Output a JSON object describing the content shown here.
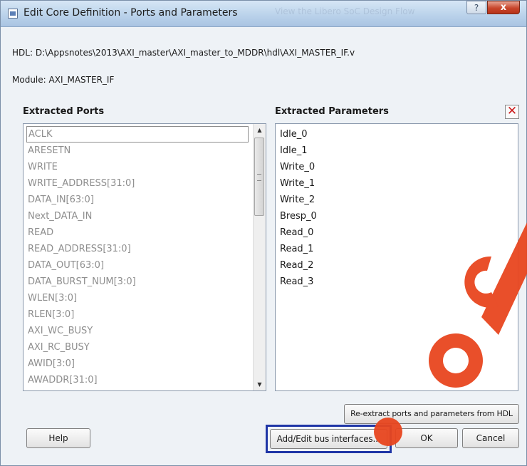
{
  "window": {
    "title": "Edit Core Definition - Ports and Parameters",
    "background_tab": "View the Libero SoC Design Flow",
    "help_glyph": "?",
    "close_glyph": "x"
  },
  "hdl": {
    "label": "HDL:",
    "path": "D:\\Appsnotes\\2013\\AXI_master\\AXI_master_to_MDDR\\hdl\\AXI_MASTER_IF.v"
  },
  "module": {
    "label": "Module:",
    "name": "AXI_MASTER_IF"
  },
  "ports": {
    "heading": "Extracted Ports",
    "items": [
      "ACLK",
      "ARESETN",
      "WRITE",
      "WRITE_ADDRESS[31:0]",
      "DATA_IN[63:0]",
      "Next_DATA_IN",
      "READ",
      "READ_ADDRESS[31:0]",
      "DATA_OUT[63:0]",
      "DATA_BURST_NUM[3:0]",
      "WLEN[3:0]",
      "RLEN[3:0]",
      "AXI_WC_BUSY",
      "AXI_RC_BUSY",
      "AWID[3:0]",
      "AWADDR[31:0]"
    ],
    "selected_index": 0
  },
  "parameters": {
    "heading": "Extracted Parameters",
    "items": [
      "Idle_0",
      "Idle_1",
      "Write_0",
      "Write_1",
      "Write_2",
      "Bresp_0",
      "Read_0",
      "Read_1",
      "Read_2",
      "Read_3"
    ]
  },
  "buttons": {
    "help": "Help",
    "reextract": "Re-extract ports and parameters from HDL",
    "bus_interfaces": "Add/Edit bus interfaces...",
    "ok": "OK",
    "cancel": "Cancel",
    "remove_glyph": "✕"
  },
  "icons": {
    "app": "window-icon",
    "remove": "red-x-icon",
    "scroll_up": "scroll-up-arrow-icon",
    "scroll_down": "scroll-down-arrow-icon"
  },
  "colors": {
    "highlight_border": "#1f36a6",
    "watermark": "#e8461f",
    "remove_x": "#cc1d1d"
  }
}
